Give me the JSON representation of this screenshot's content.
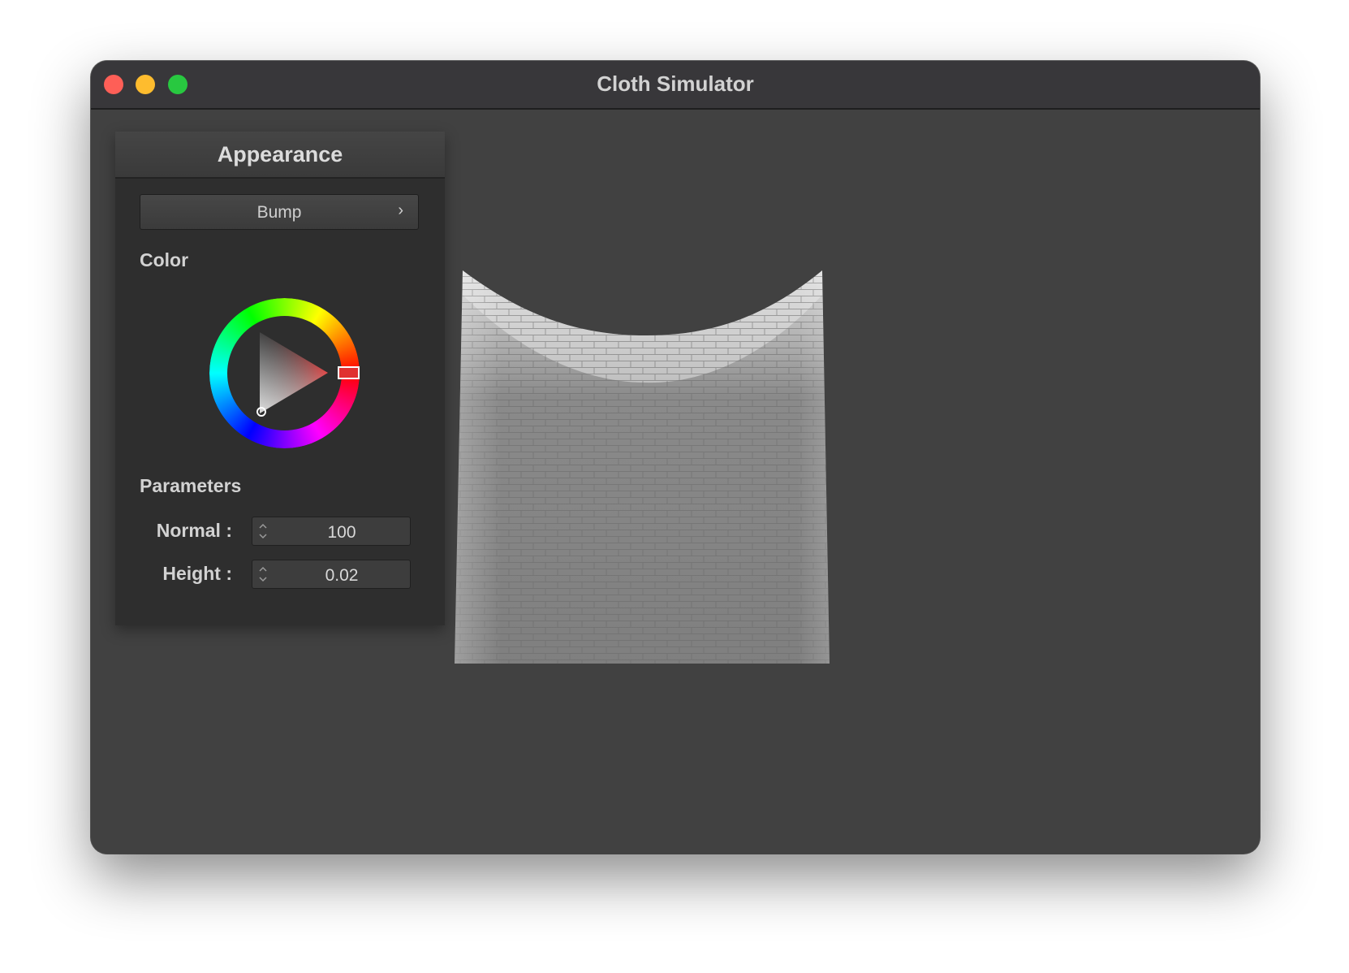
{
  "window": {
    "title": "Cloth Simulator"
  },
  "panel": {
    "title": "Appearance",
    "dropdown": {
      "selected": "Bump",
      "chevron": "›"
    },
    "color_section": {
      "label": "Color",
      "selected_hue_color": "#e03030"
    },
    "parameters": {
      "label": "Parameters",
      "fields": [
        {
          "label": "Normal :",
          "value": "100"
        },
        {
          "label": "Height :",
          "value": "0.02"
        }
      ]
    }
  },
  "colors": {
    "window_bg": "#414141",
    "titlebar_bg": "#38373a",
    "panel_bg": "#2e2e2e",
    "close": "#fe5f57",
    "minimize": "#febc2e",
    "zoom": "#28c840"
  },
  "icons": {
    "close": "close-button",
    "minimize": "minimize-button",
    "zoom": "zoom-button",
    "dropdown": "chevron-right-icon",
    "spin": "stepper-arrows-icon"
  }
}
